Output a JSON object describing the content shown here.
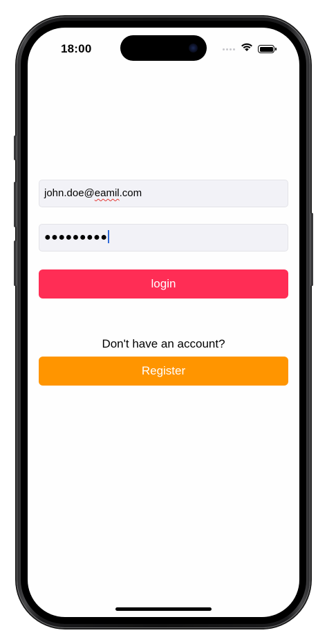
{
  "status_bar": {
    "time": "18:00",
    "icons": [
      "cellular-signal-icon",
      "wifi-icon",
      "battery-icon"
    ]
  },
  "login_form": {
    "email_value": "john.doe@eamil.com",
    "password_value": "●●●●●●●●●",
    "login_label": "login",
    "login_color": "#ff2d55"
  },
  "register_section": {
    "prompt": "Don't have an account?",
    "register_label": "Register",
    "register_color": "#ff9500"
  }
}
